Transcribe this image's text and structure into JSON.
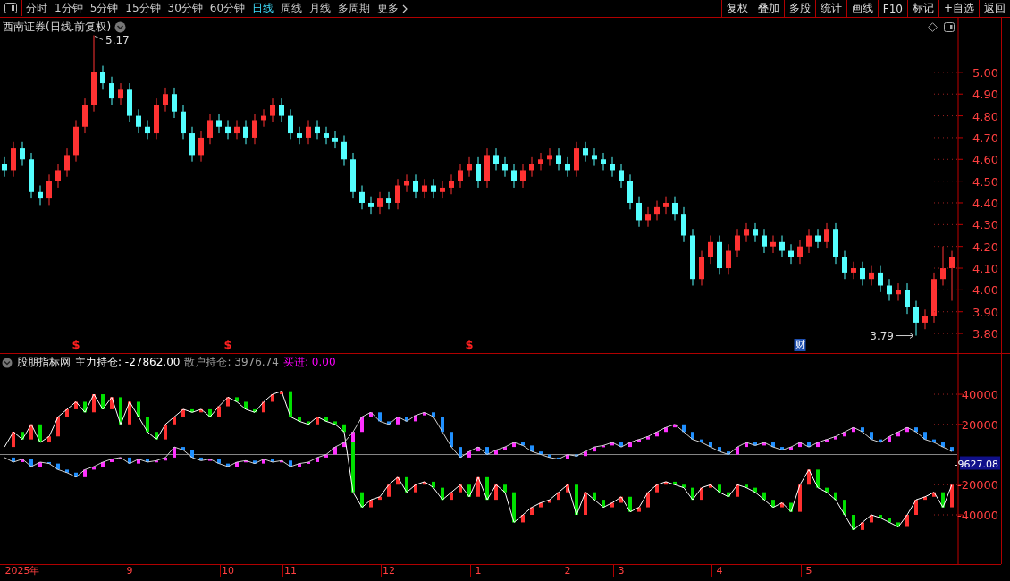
{
  "toolbar": {
    "tabs": [
      {
        "label": "分时",
        "selected": false
      },
      {
        "label": "1分钟",
        "selected": false
      },
      {
        "label": "5分钟",
        "selected": false
      },
      {
        "label": "15分钟",
        "selected": false
      },
      {
        "label": "30分钟",
        "selected": false
      },
      {
        "label": "60分钟",
        "selected": false
      },
      {
        "label": "日线",
        "selected": true
      },
      {
        "label": "周线",
        "selected": false
      },
      {
        "label": "月线",
        "selected": false
      },
      {
        "label": "多周期",
        "selected": false
      }
    ],
    "more": "更多",
    "buttons": [
      "复权",
      "叠加",
      "多股",
      "统计",
      "画线",
      "F10",
      "标记",
      "+自选",
      "返回"
    ]
  },
  "price_panel": {
    "title": "西南证券(日线.前复权)",
    "chart_data": {
      "type": "candlestick",
      "ylim": [
        3.71,
        5.25
      ],
      "yticks": [
        {
          "value": 3.8,
          "label": "3.80"
        },
        {
          "value": 3.9,
          "label": "3.90"
        },
        {
          "value": 4.0,
          "label": "4.00"
        },
        {
          "value": 4.1,
          "label": "4.10"
        },
        {
          "value": 4.2,
          "label": "4.20"
        },
        {
          "value": 4.3,
          "label": "4.30"
        },
        {
          "value": 4.4,
          "label": "4.40"
        },
        {
          "value": 4.5,
          "label": "4.50"
        },
        {
          "value": 4.6,
          "label": "4.60"
        },
        {
          "value": 4.7,
          "label": "4.70"
        },
        {
          "value": 4.8,
          "label": "4.80"
        },
        {
          "value": 4.9,
          "label": "4.90"
        },
        {
          "value": 5.0,
          "label": "5.00"
        }
      ],
      "categories": [
        null,
        null,
        null,
        null,
        null,
        null,
        null,
        null,
        null,
        null,
        null,
        null,
        null,
        null,
        null,
        null,
        null,
        null,
        null,
        null,
        null,
        null,
        null,
        null,
        null,
        null,
        null,
        null,
        null,
        null,
        null,
        null,
        null,
        null,
        null,
        null,
        null,
        null,
        null,
        null,
        null,
        null,
        null,
        null,
        null,
        null,
        null,
        null,
        null,
        null,
        null,
        null,
        null,
        null,
        null,
        null,
        null,
        null,
        null,
        null,
        null,
        null,
        null,
        null,
        null,
        null,
        null,
        null,
        null,
        null,
        null,
        null,
        null,
        null,
        null,
        null,
        null,
        null,
        null,
        null,
        null,
        null,
        null,
        null,
        null,
        null,
        null,
        null,
        null,
        null,
        null,
        null,
        null,
        null,
        null,
        null,
        null,
        null,
        null,
        null,
        null,
        null,
        null,
        null,
        null,
        null,
        null
      ],
      "ohlc": [
        [
          4.58,
          4.61,
          4.52,
          4.55
        ],
        [
          4.55,
          4.68,
          4.52,
          4.65
        ],
        [
          4.65,
          4.68,
          4.57,
          4.6
        ],
        [
          4.6,
          4.63,
          4.42,
          4.45
        ],
        [
          4.45,
          4.48,
          4.39,
          4.42
        ],
        [
          4.42,
          4.53,
          4.39,
          4.5
        ],
        [
          4.5,
          4.58,
          4.47,
          4.55
        ],
        [
          4.55,
          4.65,
          4.52,
          4.62
        ],
        [
          4.62,
          4.78,
          4.59,
          4.75
        ],
        [
          4.75,
          4.88,
          4.72,
          4.85
        ],
        [
          4.85,
          5.17,
          4.82,
          5.0
        ],
        [
          5.0,
          5.03,
          4.92,
          4.95
        ],
        [
          4.95,
          4.98,
          4.85,
          4.88
        ],
        [
          4.88,
          4.95,
          4.85,
          4.92
        ],
        [
          4.92,
          4.95,
          4.77,
          4.8
        ],
        [
          4.8,
          4.83,
          4.72,
          4.75
        ],
        [
          4.75,
          4.78,
          4.69,
          4.72
        ],
        [
          4.72,
          4.88,
          4.69,
          4.85
        ],
        [
          4.85,
          4.93,
          4.82,
          4.9
        ],
        [
          4.9,
          4.93,
          4.79,
          4.82
        ],
        [
          4.82,
          4.85,
          4.69,
          4.72
        ],
        [
          4.72,
          4.75,
          4.59,
          4.62
        ],
        [
          4.62,
          4.73,
          4.59,
          4.7
        ],
        [
          4.7,
          4.81,
          4.67,
          4.78
        ],
        [
          4.78,
          4.81,
          4.72,
          4.75
        ],
        [
          4.75,
          4.78,
          4.69,
          4.72
        ],
        [
          4.72,
          4.78,
          4.69,
          4.75
        ],
        [
          4.75,
          4.78,
          4.67,
          4.7
        ],
        [
          4.7,
          4.81,
          4.67,
          4.78
        ],
        [
          4.78,
          4.83,
          4.75,
          4.8
        ],
        [
          4.8,
          4.88,
          4.77,
          4.85
        ],
        [
          4.85,
          4.88,
          4.77,
          4.8
        ],
        [
          4.8,
          4.83,
          4.69,
          4.72
        ],
        [
          4.72,
          4.75,
          4.67,
          4.7
        ],
        [
          4.7,
          4.78,
          4.67,
          4.75
        ],
        [
          4.75,
          4.78,
          4.69,
          4.72
        ],
        [
          4.72,
          4.75,
          4.67,
          4.7
        ],
        [
          4.7,
          4.73,
          4.65,
          4.68
        ],
        [
          4.68,
          4.71,
          4.57,
          4.6
        ],
        [
          4.6,
          4.63,
          4.42,
          4.45
        ],
        [
          4.45,
          4.48,
          4.37,
          4.4
        ],
        [
          4.4,
          4.43,
          4.35,
          4.38
        ],
        [
          4.38,
          4.45,
          4.35,
          4.42
        ],
        [
          4.42,
          4.45,
          4.37,
          4.4
        ],
        [
          4.4,
          4.51,
          4.37,
          4.48
        ],
        [
          4.48,
          4.53,
          4.45,
          4.5
        ],
        [
          4.5,
          4.53,
          4.42,
          4.45
        ],
        [
          4.45,
          4.51,
          4.42,
          4.48
        ],
        [
          4.48,
          4.51,
          4.42,
          4.45
        ],
        [
          4.45,
          4.5,
          4.42,
          4.47
        ],
        [
          4.47,
          4.53,
          4.44,
          4.5
        ],
        [
          4.5,
          4.58,
          4.47,
          4.55
        ],
        [
          4.55,
          4.61,
          4.52,
          4.58
        ],
        [
          4.58,
          4.61,
          4.47,
          4.5
        ],
        [
          4.5,
          4.65,
          4.47,
          4.62
        ],
        [
          4.62,
          4.65,
          4.55,
          4.58
        ],
        [
          4.58,
          4.61,
          4.52,
          4.55
        ],
        [
          4.55,
          4.58,
          4.47,
          4.5
        ],
        [
          4.5,
          4.58,
          4.47,
          4.55
        ],
        [
          4.55,
          4.61,
          4.52,
          4.58
        ],
        [
          4.58,
          4.63,
          4.55,
          4.6
        ],
        [
          4.6,
          4.65,
          4.57,
          4.62
        ],
        [
          4.62,
          4.65,
          4.55,
          4.58
        ],
        [
          4.58,
          4.61,
          4.52,
          4.55
        ],
        [
          4.55,
          4.68,
          4.52,
          4.65
        ],
        [
          4.65,
          4.68,
          4.59,
          4.62
        ],
        [
          4.62,
          4.65,
          4.57,
          4.6
        ],
        [
          4.6,
          4.63,
          4.55,
          4.58
        ],
        [
          4.58,
          4.61,
          4.52,
          4.55
        ],
        [
          4.55,
          4.58,
          4.47,
          4.5
        ],
        [
          4.5,
          4.53,
          4.37,
          4.4
        ],
        [
          4.4,
          4.43,
          4.29,
          4.32
        ],
        [
          4.32,
          4.38,
          4.29,
          4.35
        ],
        [
          4.35,
          4.41,
          4.32,
          4.38
        ],
        [
          4.38,
          4.43,
          4.35,
          4.4
        ],
        [
          4.4,
          4.43,
          4.32,
          4.35
        ],
        [
          4.35,
          4.38,
          4.22,
          4.25
        ],
        [
          4.25,
          4.28,
          4.02,
          4.05
        ],
        [
          4.05,
          4.18,
          4.02,
          4.15
        ],
        [
          4.15,
          4.25,
          4.12,
          4.22
        ],
        [
          4.22,
          4.25,
          4.07,
          4.1
        ],
        [
          4.1,
          4.21,
          4.07,
          4.18
        ],
        [
          4.18,
          4.28,
          4.15,
          4.25
        ],
        [
          4.25,
          4.31,
          4.22,
          4.28
        ],
        [
          4.28,
          4.31,
          4.22,
          4.25
        ],
        [
          4.25,
          4.28,
          4.17,
          4.2
        ],
        [
          4.2,
          4.25,
          4.17,
          4.22
        ],
        [
          4.22,
          4.25,
          4.15,
          4.18
        ],
        [
          4.18,
          4.21,
          4.12,
          4.15
        ],
        [
          4.15,
          4.23,
          4.12,
          4.2
        ],
        [
          4.2,
          4.28,
          4.17,
          4.25
        ],
        [
          4.25,
          4.28,
          4.19,
          4.22
        ],
        [
          4.22,
          4.31,
          4.19,
          4.28
        ],
        [
          4.28,
          4.31,
          4.12,
          4.15
        ],
        [
          4.15,
          4.18,
          4.05,
          4.08
        ],
        [
          4.08,
          4.13,
          4.05,
          4.1
        ],
        [
          4.1,
          4.13,
          4.02,
          4.05
        ],
        [
          4.05,
          4.11,
          4.02,
          4.08
        ],
        [
          4.08,
          4.11,
          3.99,
          4.02
        ],
        [
          4.02,
          4.05,
          3.95,
          3.98
        ],
        [
          3.98,
          4.03,
          3.95,
          4.0
        ],
        [
          4.0,
          4.03,
          3.89,
          3.92
        ],
        [
          3.92,
          3.95,
          3.79,
          3.85
        ],
        [
          3.85,
          3.91,
          3.82,
          3.88
        ],
        [
          3.88,
          4.08,
          3.85,
          4.05
        ],
        [
          4.05,
          4.2,
          4.02,
          4.1
        ],
        [
          4.1,
          4.18,
          3.95,
          4.15
        ]
      ],
      "annotations": [
        "5.17",
        "3.79"
      ]
    },
    "event_markers": [
      {
        "kind": "dividend",
        "text": "$"
      },
      {
        "kind": "dividend",
        "text": "$"
      },
      {
        "kind": "dividend",
        "text": "$"
      },
      {
        "kind": "report",
        "text": "财"
      }
    ]
  },
  "indicator_panel": {
    "legend": [
      {
        "text": "股朋指标网"
      },
      {
        "text": "主力持仓: -27862.00",
        "color": "#ffffff"
      },
      {
        "text": "散户持仓: 3976.74",
        "color": "#a0a0a0"
      },
      {
        "text": "买进: 0.00",
        "color": "#ff00ff"
      }
    ],
    "current_value": "-9627.08",
    "chart_data": {
      "type": "line",
      "ylim": [
        -72600,
        66700
      ],
      "yticks": [
        -40000,
        -20000,
        20000,
        40000
      ],
      "categories": [
        null,
        null,
        "2025年",
        null,
        null,
        null,
        null,
        null,
        null,
        null,
        null,
        null,
        null,
        null,
        "9",
        null,
        null,
        null,
        null,
        null,
        null,
        null,
        null,
        null,
        null,
        "10",
        null,
        null,
        null,
        null,
        null,
        null,
        "11",
        null,
        null,
        null,
        null,
        null,
        null,
        null,
        null,
        null,
        null,
        "12",
        null,
        null,
        null,
        null,
        null,
        null,
        null,
        null,
        null,
        "1",
        null,
        null,
        null,
        null,
        null,
        null,
        null,
        null,
        null,
        "2",
        null,
        null,
        null,
        null,
        null,
        "3",
        null,
        null,
        null,
        null,
        null,
        null,
        null,
        null,
        null,
        null,
        "4",
        null,
        null,
        null,
        null,
        null,
        null,
        null,
        null,
        null,
        "5",
        null,
        null,
        null,
        null,
        null,
        null,
        null,
        null,
        null,
        null,
        null,
        null,
        null,
        null,
        null,
        null
      ],
      "series": [
        {
          "color": "#ffffff",
          "values": [
            5000,
            15000,
            10000,
            20000,
            8000,
            12000,
            25000,
            30000,
            35000,
            28000,
            40000,
            30000,
            38000,
            20000,
            35000,
            25000,
            15000,
            10000,
            20000,
            25000,
            30000,
            28000,
            30000,
            25000,
            32000,
            38000,
            35000,
            30000,
            28000,
            35000,
            40000,
            42000,
            25000,
            22000,
            20000,
            25000,
            22000,
            20000,
            15000,
            -25000,
            -35000,
            -30000,
            -28000,
            -20000,
            -15000,
            -25000,
            -20000,
            -18000,
            -22000,
            -30000,
            -25000,
            -20000,
            -28000,
            -15000,
            -30000,
            -20000,
            -25000,
            -45000,
            -40000,
            -35000,
            -32000,
            -30000,
            -25000,
            -20000,
            -40000,
            -25000,
            -30000,
            -35000,
            -32000,
            -28000,
            -38000,
            -35000,
            -25000,
            -20000,
            -18000,
            -20000,
            -22000,
            -30000,
            -22000,
            -20000,
            -25000,
            -28000,
            -20000,
            -22000,
            -25000,
            -30000,
            -35000,
            -32000,
            -38000,
            -20000,
            -10000,
            -22000,
            -25000,
            -30000,
            -40000,
            -50000,
            -45000,
            -40000,
            -42000,
            -45000,
            -48000,
            -40000,
            -30000,
            -28000,
            -25000,
            -35000,
            -20000
          ]
        },
        {
          "color": "#d0d0d0",
          "values": [
            -2000,
            -5000,
            -3000,
            -8000,
            -5000,
            -6000,
            -10000,
            -12000,
            -15000,
            -10000,
            -8000,
            -5000,
            -3000,
            -2000,
            -6000,
            -3000,
            -5000,
            -4000,
            -2000,
            5000,
            3000,
            -2000,
            -4000,
            -3000,
            -6000,
            -8000,
            -5000,
            -4000,
            -6000,
            -3000,
            -5000,
            -4000,
            -8000,
            -6000,
            -5000,
            -2000,
            0,
            5000,
            8000,
            15000,
            25000,
            28000,
            22000,
            20000,
            25000,
            22000,
            26000,
            28000,
            25000,
            15000,
            5000,
            -2000,
            2000,
            5000,
            0,
            3000,
            5000,
            8000,
            6000,
            2000,
            0,
            -2000,
            -3000,
            0,
            -1000,
            2000,
            5000,
            6000,
            8000,
            5000,
            8000,
            10000,
            12000,
            15000,
            18000,
            20000,
            15000,
            10000,
            8000,
            5000,
            2000,
            0,
            5000,
            8000,
            6000,
            8000,
            5000,
            3000,
            5000,
            8000,
            5000,
            8000,
            10000,
            12000,
            15000,
            18000,
            15000,
            10000,
            8000,
            12000,
            15000,
            18000,
            15000,
            10000,
            8000,
            5000,
            2000
          ]
        }
      ]
    }
  }
}
